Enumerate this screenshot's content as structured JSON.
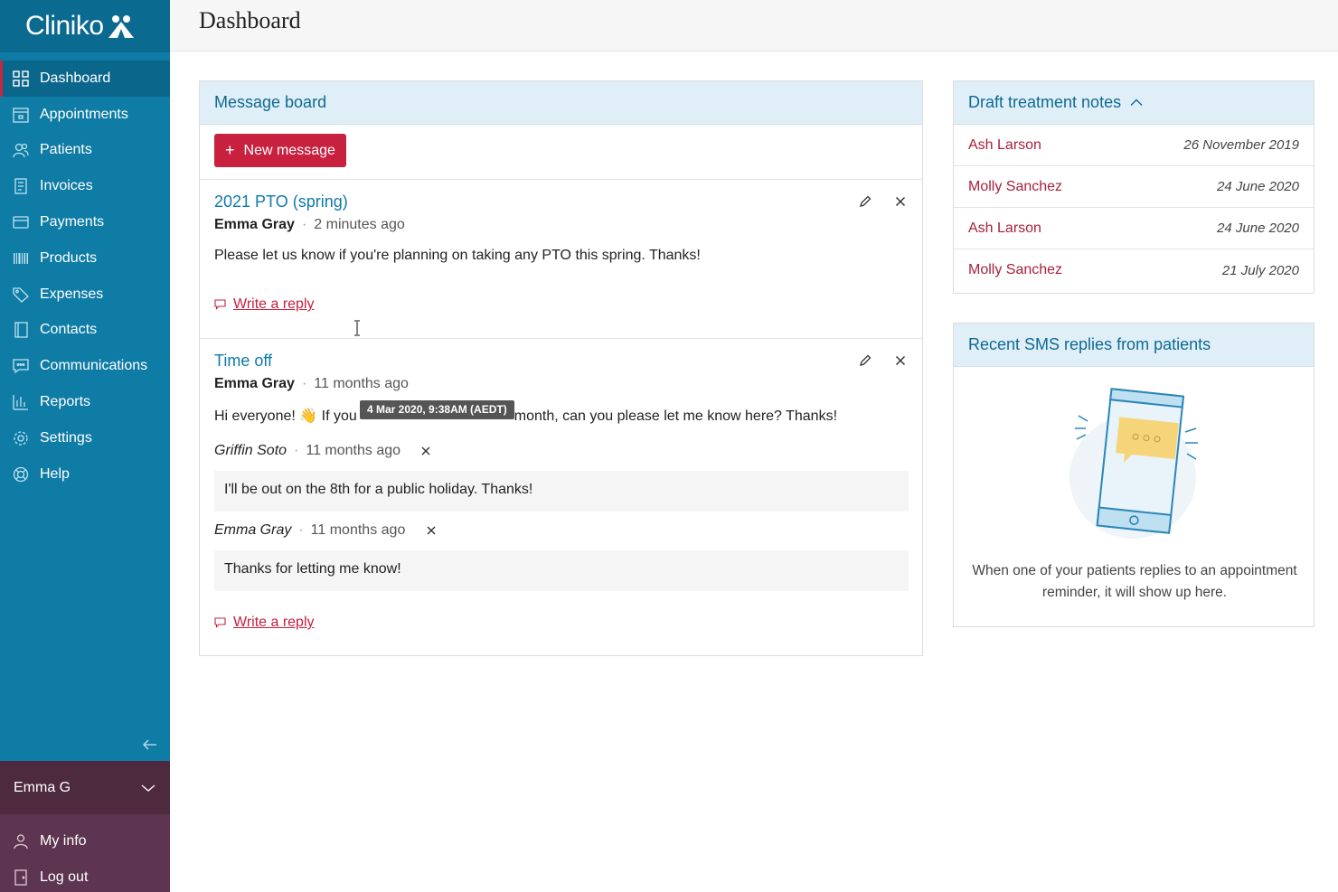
{
  "app": {
    "logo_text": "Cliniko"
  },
  "header": {
    "title": "Dashboard"
  },
  "sidebar": {
    "items": [
      {
        "label": "Dashboard",
        "icon": "dashboard-icon",
        "active": true
      },
      {
        "label": "Appointments",
        "icon": "calendar-icon"
      },
      {
        "label": "Patients",
        "icon": "patients-icon"
      },
      {
        "label": "Invoices",
        "icon": "invoice-icon"
      },
      {
        "label": "Payments",
        "icon": "payment-card-icon"
      },
      {
        "label": "Products",
        "icon": "barcode-icon"
      },
      {
        "label": "Expenses",
        "icon": "tag-icon"
      },
      {
        "label": "Contacts",
        "icon": "address-book-icon"
      },
      {
        "label": "Communications",
        "icon": "chat-icon"
      },
      {
        "label": "Reports",
        "icon": "bar-chart-icon"
      },
      {
        "label": "Settings",
        "icon": "gear-icon"
      },
      {
        "label": "Help",
        "icon": "lifebuoy-icon"
      }
    ],
    "user_name": "Emma G",
    "user_links": [
      {
        "label": "My info",
        "icon": "user-icon"
      },
      {
        "label": "Log out",
        "icon": "door-icon"
      }
    ]
  },
  "message_board": {
    "title": "Message board",
    "new_message_label": "New message",
    "posts": [
      {
        "title": "2021 PTO (spring)",
        "author": "Emma Gray",
        "time": "2 minutes ago",
        "body": "Please let us know if you're planning on taking any PTO this spring. Thanks!",
        "reply_label": "Write a reply"
      },
      {
        "title": "Time off",
        "author": "Emma Gray",
        "time": "11 months ago",
        "body_start": "Hi everyone! 👋  If you",
        "body_end": "month, can you please let me know here? Thanks!",
        "tooltip": "4 Mar 2020, 9:38AM (AEDT)",
        "comments": [
          {
            "author": "Griffin Soto",
            "time": "11 months ago",
            "body": "I'll be out on the 8th for a public holiday. Thanks!"
          },
          {
            "author": "Emma Gray",
            "time": "11 months ago",
            "body": "Thanks for letting me know!"
          }
        ],
        "reply_label": "Write a reply"
      }
    ]
  },
  "draft_notes": {
    "title": "Draft treatment notes",
    "rows": [
      {
        "name": "Ash Larson",
        "date": "26 November 2019"
      },
      {
        "name": "Molly Sanchez",
        "date": "24 June 2020"
      },
      {
        "name": "Ash Larson",
        "date": "24 June 2020"
      },
      {
        "name": "Molly Sanchez",
        "date": "21 July 2020"
      }
    ]
  },
  "sms_replies": {
    "title": "Recent SMS replies from patients",
    "empty_text": "When one of your patients replies to an appointment reminder, it will show up here."
  },
  "colors": {
    "sidebar": "#0f7ca6",
    "user_bar": "#4e2a3e",
    "accent_red": "#c8203f",
    "link_blue": "#0d79ab",
    "panel_head": "#e0eff7"
  }
}
